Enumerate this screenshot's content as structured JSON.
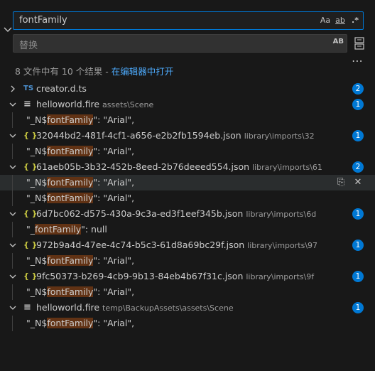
{
  "search": {
    "value": "fontFamily",
    "opt_case": "Aa",
    "opt_word": "ab",
    "opt_regex": ".*"
  },
  "replace": {
    "placeholder": "替换",
    "toggle_label": "AB"
  },
  "summary": {
    "text": "8 文件中有 10 个结果 - ",
    "link": "在编辑器中打开"
  },
  "files": [
    {
      "type": "TS",
      "name": "creator.d.ts",
      "path": "",
      "count": "2",
      "expanded": false,
      "matches": []
    },
    {
      "type": "fire",
      "name": "helloworld.fire",
      "path": "assets\\Scene",
      "count": "1",
      "expanded": true,
      "matches": [
        {
          "before": "\"_N$",
          "hit": "fontFamily",
          "after": "\": \"Arial\","
        }
      ]
    },
    {
      "type": "json",
      "name": "32044bd2-481f-4cf1-a656-e2b2fb1594eb.json",
      "path": "library\\imports\\32",
      "count": "1",
      "expanded": true,
      "matches": [
        {
          "before": "\"_N$",
          "hit": "fontFamily",
          "after": "\": \"Arial\","
        }
      ]
    },
    {
      "type": "json",
      "name": "61aeb05b-3b32-452b-8eed-2b76deeed554.json",
      "path": "library\\imports\\61",
      "count": "2",
      "expanded": true,
      "matches": [
        {
          "before": "\"_N$",
          "hit": "fontFamily",
          "after": "\": \"Arial\",",
          "hover": true
        },
        {
          "before": "\"_N$",
          "hit": "fontFamily",
          "after": "\": \"Arial\","
        }
      ]
    },
    {
      "type": "json",
      "name": "6d7bc062-d575-430a-9c3a-ed3f1eef345b.json",
      "path": "library\\imports\\6d",
      "count": "1",
      "expanded": true,
      "matches": [
        {
          "before": "\"_",
          "hit": "fontFamily",
          "after": "\": null"
        }
      ]
    },
    {
      "type": "json",
      "name": "972b9a4d-47ee-4c74-b5c3-61d8a69bc29f.json",
      "path": "library\\imports\\97",
      "count": "1",
      "expanded": true,
      "matches": [
        {
          "before": "\"_N$",
          "hit": "fontFamily",
          "after": "\": \"Arial\","
        }
      ]
    },
    {
      "type": "json",
      "name": "9fc50373-b269-4cb9-9b13-84eb4b67f31c.json",
      "path": "library\\imports\\9f",
      "count": "1",
      "expanded": true,
      "matches": [
        {
          "before": "\"_N$",
          "hit": "fontFamily",
          "after": "\": \"Arial\","
        }
      ]
    },
    {
      "type": "fire",
      "name": "helloworld.fire",
      "path": "temp\\BackupAssets\\assets\\Scene",
      "count": "1",
      "expanded": true,
      "matches": [
        {
          "before": "\"_N$",
          "hit": "fontFamily",
          "after": "\": \"Arial\","
        }
      ]
    }
  ],
  "colors": {
    "accent": "#0078d4",
    "highlight": "#613214",
    "link": "#4daafc",
    "json_icon": "#cbcb41",
    "ts_icon": "#4d94d6"
  }
}
